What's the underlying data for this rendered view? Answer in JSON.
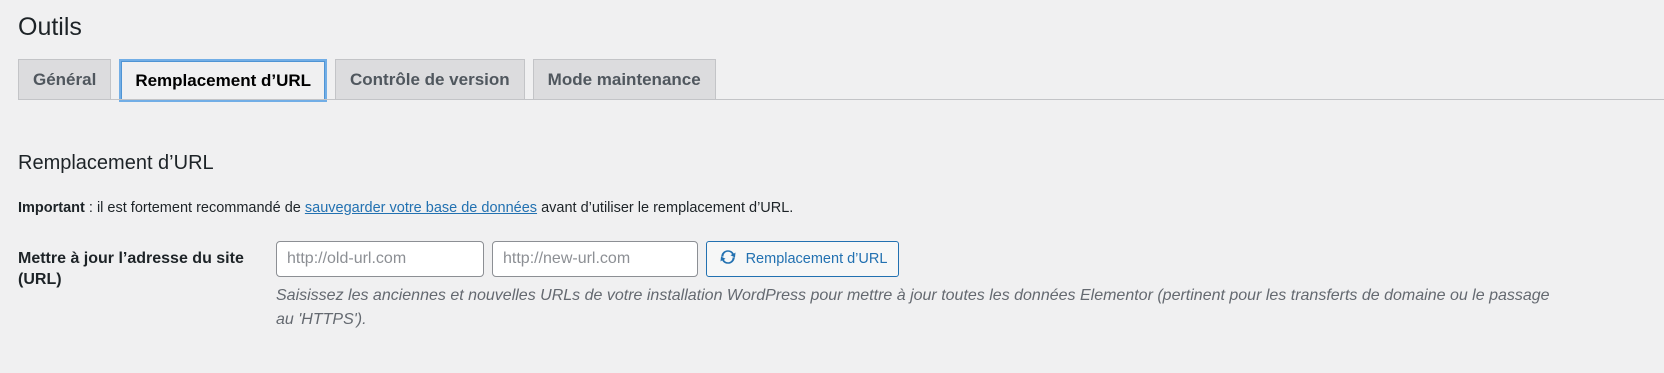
{
  "page": {
    "title": "Outils"
  },
  "tabs": [
    {
      "label": "Général",
      "active": false
    },
    {
      "label": "Remplacement d’URL",
      "active": true
    },
    {
      "label": "Contrôle de version",
      "active": false
    },
    {
      "label": "Mode maintenance",
      "active": false
    }
  ],
  "section": {
    "title": "Remplacement d’URL",
    "notice": {
      "strong": "Important",
      "text_before": " : il est fortement recommandé de ",
      "link": "sauvegarder votre base de données",
      "text_after": " avant d’utiliser le remplacement d’URL."
    },
    "row": {
      "label": "Mettre à jour l’adresse du site (URL)",
      "old_url": {
        "value": "",
        "placeholder": "http://old-url.com"
      },
      "new_url": {
        "value": "",
        "placeholder": "http://new-url.com"
      },
      "button": {
        "label": "Remplacement d’URL",
        "icon": "sync-icon"
      },
      "description": "Saisissez les anciennes et nouvelles URLs de votre installation WordPress pour mettre à jour toutes les données Elementor (pertinent pour les transferts de domaine ou le passage au 'HTTPS')."
    }
  },
  "colors": {
    "background": "#f0f0f1",
    "link": "#2271b1",
    "active_tab_border": "#72aee6",
    "inactive_tab_bg": "#dcdcde"
  }
}
